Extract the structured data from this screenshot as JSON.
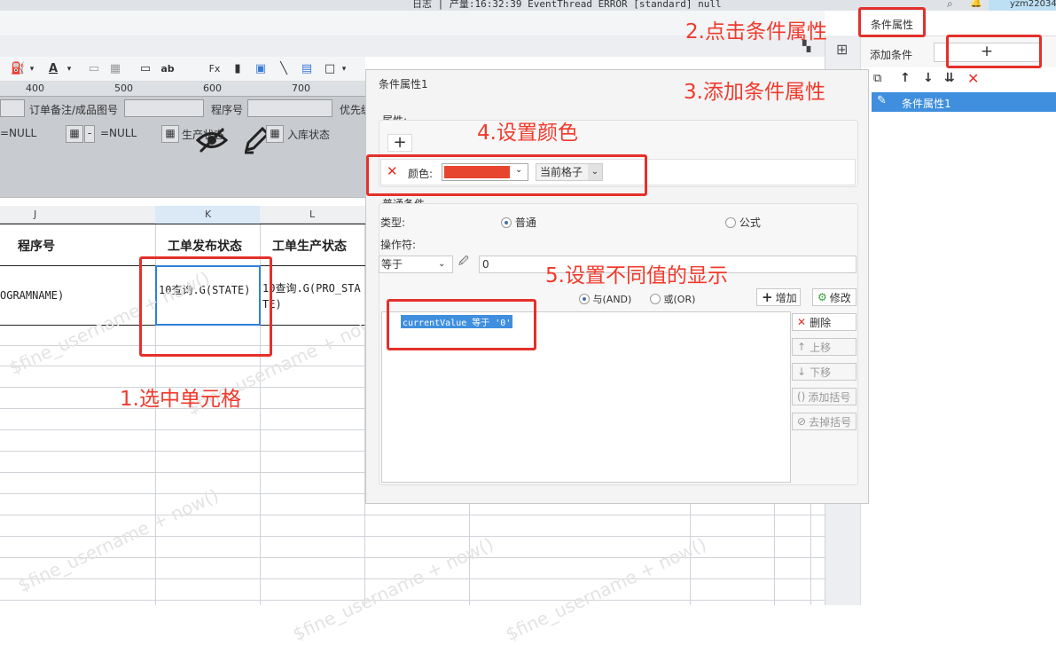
{
  "statusbar": {
    "message": "日志 | 产量:16:32:39 EventThread ERROR [standard] null",
    "user": "yzm22034"
  },
  "ruler": {
    "ticks": [
      "400",
      "500",
      "600",
      "700"
    ]
  },
  "params": {
    "order_remark_label": "订单备注/成品图号",
    "program_label": "程序号",
    "priority_label": "优先级",
    "null_value_1": "=NULL",
    "null_value_2": "=NULL",
    "production_status_label": "生产状态",
    "inbound_status_label": "入库状态",
    "dash": "-"
  },
  "sheet": {
    "columns": [
      "J",
      "K",
      "L"
    ],
    "headers": [
      "程序号",
      "工单发布状态",
      "工单生产状态"
    ],
    "row1": [
      "OGRAMNAME)",
      "10查询.G(STATE)",
      "10查询.G(PRO_STATE)"
    ],
    "watermark": "$fine_username + now()"
  },
  "right_panel": {
    "title": "条件属性",
    "add_condition_label": "添加条件",
    "add_symbol": "+",
    "list_items": [
      "条件属性1"
    ]
  },
  "dialog": {
    "title": "条件属性1",
    "attribute_label": "属性:",
    "add_symbol": "+",
    "color_label": "颜色:",
    "color_value": "#e8452e",
    "scope_value": "当前格子",
    "normal_condition_label": "普通条件",
    "type_label": "类型:",
    "type_normal": "普通",
    "type_formula": "公式",
    "operator_label": "操作符:",
    "operator_value": "等于",
    "operand_value": "0",
    "and_label": "与(AND)",
    "or_label": "或(OR)",
    "add_button": "增加",
    "modify_button": "修改",
    "delete_button": "删除",
    "up_button": "上移",
    "down_button": "下移",
    "add_paren_button": "添加括号",
    "remove_paren_button": "去掉括号",
    "condition_item": "currentValue 等于 '0'"
  },
  "annotations": {
    "step1": "1.选中单元格",
    "step2": "2.点击条件属性",
    "step3": "3.添加条件属性",
    "step4": "4.设置颜色",
    "step5": "5.设置不同值的显示"
  },
  "colors": {
    "annotation_red": "#f03a2c",
    "selection_blue": "#2f7fd8",
    "list_selected": "#3f8fde"
  },
  "icons": [
    "paint-bucket-icon",
    "font-color-icon",
    "border-icon",
    "merge-icon",
    "insert-row-icon",
    "text-icon",
    "formula-icon",
    "bar-chart-icon",
    "image-icon",
    "slash-icon",
    "book-icon",
    "border-style-icon",
    "hide-icon",
    "edit-icon",
    "calendar-icon",
    "copy-icon",
    "arrow-up-icon",
    "arrow-down-icon",
    "sort-icon",
    "close-icon",
    "search-icon",
    "bell-icon"
  ]
}
